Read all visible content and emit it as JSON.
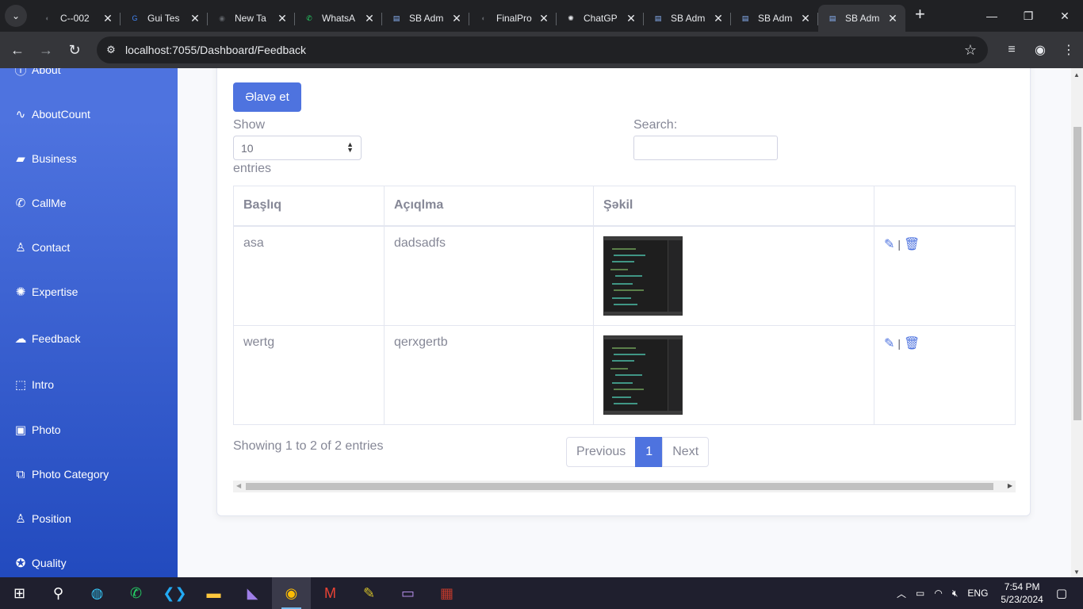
{
  "browser": {
    "tabs": [
      {
        "title": "C--002",
        "color": "#5f6368",
        "glyph": "◐"
      },
      {
        "title": "Gui Tes",
        "color": "#4285f4",
        "glyph": "G"
      },
      {
        "title": "New Ta",
        "color": "#5f6368",
        "glyph": "◉"
      },
      {
        "title": "WhatsA",
        "color": "#25d366",
        "glyph": "✆"
      },
      {
        "title": "SB Adm",
        "color": "#8ab4f8",
        "glyph": "▤"
      },
      {
        "title": "FinalPro",
        "color": "#5f6368",
        "glyph": "◐"
      },
      {
        "title": "ChatGP",
        "color": "#e8eaed",
        "glyph": "✺"
      },
      {
        "title": "SB Adm",
        "color": "#8ab4f8",
        "glyph": "▤"
      },
      {
        "title": "SB Adm",
        "color": "#8ab4f8",
        "glyph": "▤"
      },
      {
        "title": "SB Adm",
        "color": "#8ab4f8",
        "glyph": "▤"
      }
    ],
    "url": "localhost:7055/Dashboard/Feedback"
  },
  "sidebar": {
    "items": [
      {
        "label": "About",
        "icon": "info-icon"
      },
      {
        "label": "AboutCount",
        "icon": "pulse-icon"
      },
      {
        "label": "Business",
        "icon": "briefcase-icon"
      },
      {
        "label": "CallMe",
        "icon": "phone-icon"
      },
      {
        "label": "Contact",
        "icon": "user-cog-icon"
      },
      {
        "label": "Expertise",
        "icon": "lightbulb-head-icon"
      },
      {
        "label": "Feedback",
        "icon": "comments-icon"
      },
      {
        "label": "Intro",
        "icon": "chart-image-icon"
      },
      {
        "label": "Photo",
        "icon": "image-icon"
      },
      {
        "label": "Photo Category",
        "icon": "images-icon"
      },
      {
        "label": "Position",
        "icon": "user-tie-icon"
      },
      {
        "label": "Quality",
        "icon": "award-icon"
      }
    ]
  },
  "main": {
    "add_button": "Əlavə et",
    "show_label": "Show",
    "page_size": "10",
    "entries_label": "entries",
    "search_label": "Search:",
    "search_value": "",
    "columns": [
      "Başlıq",
      "Açıqlma",
      "Şəkil",
      ""
    ],
    "rows": [
      {
        "title": "asa",
        "description": "dadsadfs"
      },
      {
        "title": "wertg",
        "description": "qerxgertb"
      }
    ],
    "action_separator": "|",
    "info": "Showing 1 to 2 of 2 entries",
    "pagination": {
      "previous": "Previous",
      "current": "1",
      "next": "Next"
    }
  },
  "taskbar": {
    "language": "ENG",
    "time": "7:54 PM",
    "date": "5/23/2024"
  },
  "colors": {
    "primary": "#4e73df",
    "sidebar_end": "#224abe"
  }
}
